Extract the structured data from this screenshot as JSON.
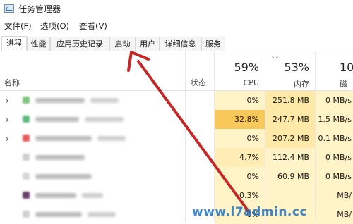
{
  "window": {
    "title": "任务管理器"
  },
  "menu": [
    {
      "label": "文件(F)"
    },
    {
      "label": "选项(O)"
    },
    {
      "label": "查看(V)"
    }
  ],
  "tabs": [
    {
      "label": "进程",
      "active": true
    },
    {
      "label": "性能"
    },
    {
      "label": "应用历史记录"
    },
    {
      "label": "启动"
    },
    {
      "label": "用户"
    },
    {
      "label": "详细信息"
    },
    {
      "label": "服务"
    }
  ],
  "columns": {
    "name": "名称",
    "status": "状态",
    "cpu": {
      "pct": "59%",
      "label": "CPU"
    },
    "memory": {
      "pct": "53%",
      "label": "内存"
    },
    "disk": {
      "pct": "10",
      "label": "磁盘"
    }
  },
  "rows": [
    {
      "cpu": "0%",
      "mem": "251.8 MB",
      "disk": "0 MB/s",
      "cpu_color": "#fff3c8",
      "mem_color": "#ffe9a8",
      "disk_color": "#fff3c8",
      "icon_color": "#7dc47f",
      "expandable": true
    },
    {
      "cpu": "32.8%",
      "mem": "247.7 MB",
      "disk": "1.5 MB/s",
      "cpu_color": "#f9c85a",
      "mem_color": "#ffe9a8",
      "disk_color": "#fff3c8",
      "icon_color": "#5fb87f",
      "expandable": true
    },
    {
      "cpu": "0%",
      "mem": "207.2 MB",
      "disk": "0.1 MB/s",
      "cpu_color": "#fff3c8",
      "mem_color": "#ffe9a8",
      "disk_color": "#fff3c8",
      "icon_color": "#e35a5a",
      "expandable": true
    },
    {
      "cpu": "4.7%",
      "mem": "112.4 MB",
      "disk": "0 MB/s",
      "cpu_color": "#ffedb5",
      "mem_color": "#fff3c8",
      "disk_color": "#fff3c8",
      "icon_color": "#cfcfcf",
      "expandable": false
    },
    {
      "cpu": "0%",
      "mem": "60.9 MB",
      "disk": "0 MB/s",
      "cpu_color": "#fff3c8",
      "mem_color": "#fff3c8",
      "disk_color": "#fff3c8",
      "icon_color": "#d6d6d6",
      "expandable": false
    },
    {
      "cpu": "0.3%",
      "mem": "",
      "disk": "MB/",
      "cpu_color": "#fff3c8",
      "mem_color": "#fff3c8",
      "disk_color": "#fff3c8",
      "icon_color": "#6a3f6a",
      "expandable": false
    },
    {
      "cpu": "0%",
      "mem": "",
      "disk": "MB/",
      "cpu_color": "#fff3c8",
      "mem_color": "#fff3c8",
      "disk_color": "#fff3c8",
      "icon_color": "#d0d0d0",
      "expandable": false
    }
  ],
  "watermark": "www.l7admin.cc",
  "colors": {
    "arrow": "#c62828",
    "watermark": "#1e72c8"
  }
}
